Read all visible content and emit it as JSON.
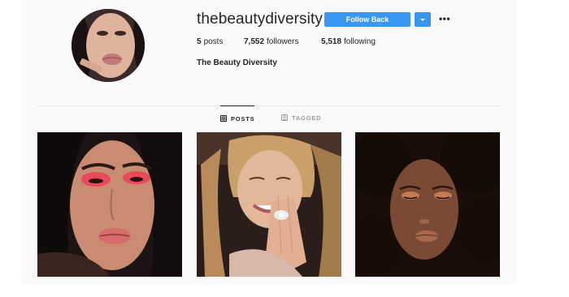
{
  "profile": {
    "username": "thebeautydiversity",
    "follow_button_label": "Follow Back",
    "more_options_label": "•••",
    "stats": {
      "posts_count": "5",
      "posts_label": "posts",
      "followers_count": "7,552",
      "followers_label": "followers",
      "following_count": "5,518",
      "following_label": "following"
    },
    "full_name": "The Beauty Diversity"
  },
  "tabs": [
    {
      "label": "POSTS",
      "icon": "grid-icon",
      "active": true
    },
    {
      "label": "TAGGED",
      "icon": "tag-icon",
      "active": false
    }
  ],
  "posts": [
    {
      "subject": "pink-glitter-eyeshadow-portrait"
    },
    {
      "subject": "laughing-woman-with-ring"
    },
    {
      "subject": "bronze-glow-curly-hair-portrait"
    }
  ],
  "colors": {
    "accent": "#3897f0",
    "text": "#262626",
    "muted": "#999999",
    "background": "#fafafa"
  }
}
